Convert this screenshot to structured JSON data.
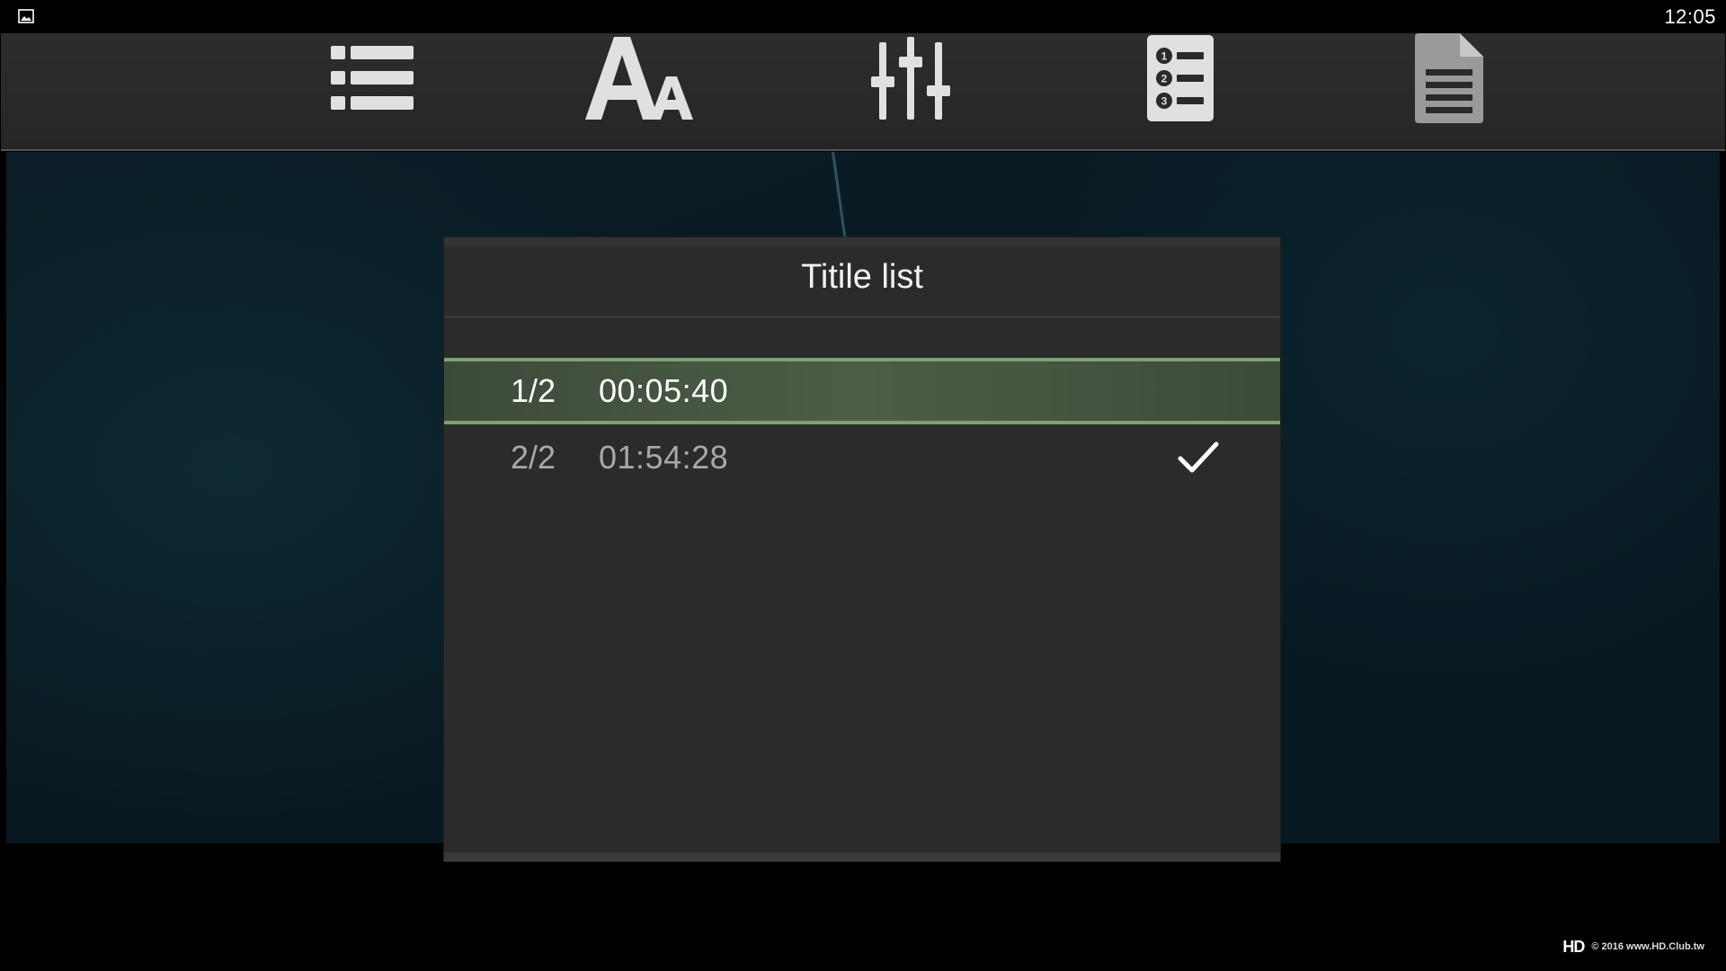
{
  "status_bar": {
    "clock": "12:05",
    "notification_icon": "image-icon"
  },
  "toolbar": {
    "items": [
      {
        "name": "list-icon"
      },
      {
        "name": "font-size-icon"
      },
      {
        "name": "equalizer-icon"
      },
      {
        "name": "numbered-list-icon"
      },
      {
        "name": "document-icon"
      }
    ]
  },
  "dialog": {
    "title": "Titile list",
    "items": [
      {
        "index": "1/2",
        "duration": "00:05:40",
        "selected": true,
        "checked": false
      },
      {
        "index": "2/2",
        "duration": "01:54:28",
        "selected": false,
        "checked": true
      }
    ]
  },
  "watermark": {
    "logo": "HD",
    "text": "© 2016  www.HD.Club.tw"
  },
  "colors": {
    "selection_highlight": "#7ea072",
    "dialog_bg": "#2b2b2b",
    "toolbar_bg": "#2a2a2a"
  }
}
